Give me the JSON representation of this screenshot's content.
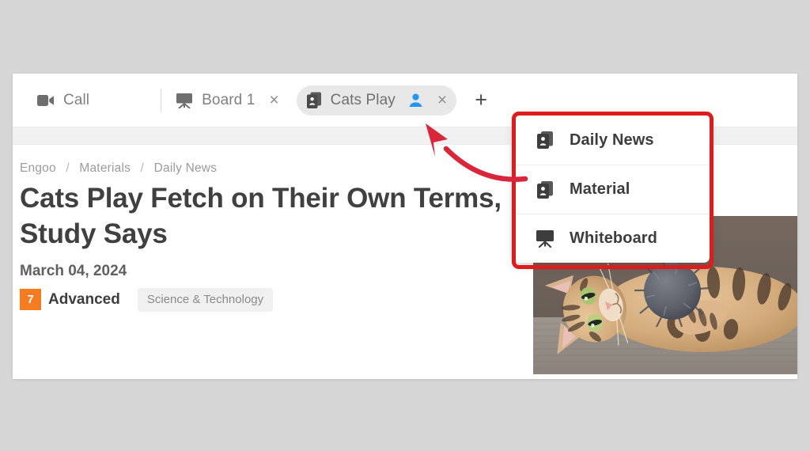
{
  "window": {
    "tabs": [
      {
        "id": "call",
        "label": "Call",
        "icon": "video-camera-icon",
        "active": false,
        "closable": false
      },
      {
        "id": "board-1",
        "label": "Board 1",
        "icon": "whiteboard-icon",
        "active": false,
        "closable": true,
        "close_label": "×"
      },
      {
        "id": "cats-play",
        "label": "Cats Play",
        "icon": "material-card-icon",
        "active": true,
        "closable": true,
        "close_label": "×",
        "participant_icon": "person-icon"
      }
    ],
    "add_tab_label": "+"
  },
  "lesson": {
    "breadcrumb": {
      "items": [
        "Engoo",
        "Materials",
        "Daily News"
      ],
      "separator": "/"
    },
    "title": "Cats Play Fetch on Their Own Terms, Study Says",
    "date": "March 04, 2024",
    "level_number": "7",
    "level_label": "Advanced",
    "category": "Science & Technology",
    "hero_image_alt": "bengal-cat-lying-with-pom-pom-toy"
  },
  "tab_type_menu": {
    "items": [
      {
        "label": "Daily News",
        "icon": "material-card-icon"
      },
      {
        "label": "Material",
        "icon": "material-card-icon"
      },
      {
        "label": "Whiteboard",
        "icon": "whiteboard-icon"
      }
    ]
  },
  "annotation": {
    "highlight_color": "#e01b1b",
    "arrow_color": "#d9263a",
    "arrow_target": "cats-play-tab"
  },
  "colors": {
    "page_background": "#d6d6d6",
    "panel_background": "#ffffff",
    "level_badge": "#f57c20",
    "active_tab_background": "#e8e8e8",
    "participant_icon": "#2196f3",
    "toolbar_strip": "#f1f1f1"
  }
}
